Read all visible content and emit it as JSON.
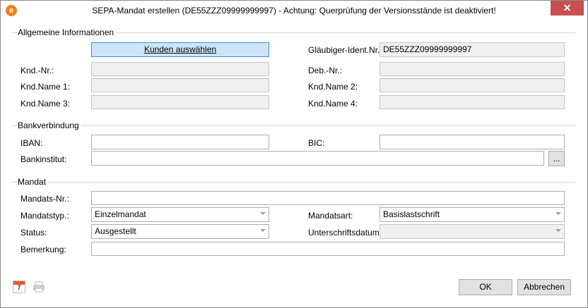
{
  "window": {
    "title": "SEPA-Mandat erstellen (DE55ZZZ09999999997) - Achtung: Querprüfung der Versionsstände ist deaktiviert!",
    "app_icon_glyph": "e",
    "close_glyph": "✕"
  },
  "general": {
    "section": "Allgemeine Informationen",
    "pick_customer": "Kunden auswählen",
    "glaeubiger_label": "Gläubiger-Ident.Nr.:",
    "glaeubiger_value": "DE55ZZZ09999999997",
    "knd_nr_label": "Knd.-Nr.:",
    "deb_nr_label": "Deb.-Nr.:",
    "knd_name1_label": "Knd.Name 1:",
    "knd_name2_label": "Knd.Name 2:",
    "knd_name3_label": "Knd.Name 3:",
    "knd_name4_label": "Knd.Name 4:"
  },
  "bank": {
    "section": "Bankverbindung",
    "iban_label": "IBAN:",
    "bic_label": "BIC:",
    "institut_label": "Bankinstitut:",
    "browse_label": "..."
  },
  "mandate": {
    "section": "Mandat",
    "nr_label": "Mandats-Nr.:",
    "typ_label": "Mandatstyp.:",
    "typ_value": "Einzelmandat",
    "art_label": "Mandatsart:",
    "art_value": "Basislastschrift",
    "status_label": "Status:",
    "status_value": "Ausgestellt",
    "sign_date_label": "Unterschriftsdatum:",
    "remark_label": "Bemerkung:"
  },
  "footer": {
    "calendar_num": "7",
    "ok_label": "OK",
    "cancel_label": "Abbrechen"
  }
}
